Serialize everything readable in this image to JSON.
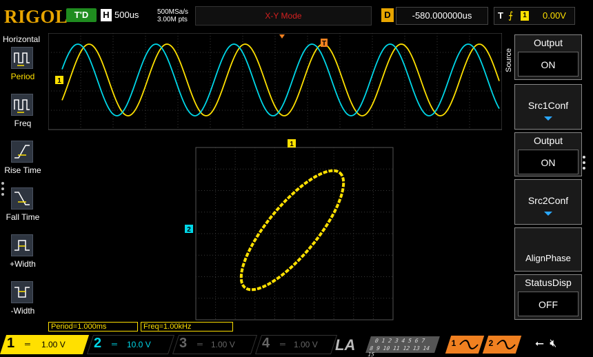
{
  "header": {
    "logo": "RIGOL",
    "run_state": "T'D",
    "horizontal_badge": "H",
    "timebase": "500us",
    "sample_rate": "500MSa/s",
    "memory_depth": "3.00M pts",
    "mode": "X-Y Mode",
    "delay_badge": "D",
    "delay_value": "-580.000000us",
    "trigger_badge": "T",
    "trigger_channel": "1",
    "trigger_level": "0.00V"
  },
  "left_menu": {
    "title": "Horizontal",
    "items": [
      {
        "label": "Period",
        "icon": "period-icon"
      },
      {
        "label": "Freq",
        "icon": "frequency-icon"
      },
      {
        "label": "Rise Time",
        "icon": "rise-time-icon"
      },
      {
        "label": "Fall Time",
        "icon": "fall-time-icon"
      },
      {
        "label": "+Width",
        "icon": "positive-width-icon"
      },
      {
        "label": "-Width",
        "icon": "negative-width-icon"
      }
    ]
  },
  "right_menu": {
    "source_label": "Source",
    "buttons": [
      {
        "head": "Output",
        "value": "ON"
      },
      {
        "label": "Src1Conf"
      },
      {
        "head": "Output",
        "value": "ON"
      },
      {
        "label": "Src2Conf"
      },
      {
        "label": "AlignPhase"
      },
      {
        "head": "StatusDisp",
        "value": "OFF"
      }
    ]
  },
  "display": {
    "ch1_marker": "1",
    "ch2_marker": "2",
    "xy_marker": "1",
    "trigger_marker": "T"
  },
  "measurements": {
    "period": "Period=1.000ms",
    "freq": "Freq=1.00kHz"
  },
  "channels": [
    {
      "num": "1",
      "scale": "1.00 V",
      "color": "#ffe000",
      "active": true
    },
    {
      "num": "2",
      "scale": "10.0 V",
      "color": "#00d7e8",
      "active": true
    },
    {
      "num": "3",
      "scale": "1.00 V",
      "color": "#666666",
      "active": false
    },
    {
      "num": "4",
      "scale": "1.00 V",
      "color": "#666666",
      "active": false
    }
  ],
  "la": {
    "label": "LA",
    "bits_top": "0 1 2 3   4 5 6 7",
    "bits_bottom": "8 9 10 11   12 13 14 15"
  },
  "sources": [
    {
      "num": "1"
    },
    {
      "num": "2"
    }
  ],
  "colors": {
    "ch1": "#ffe000",
    "ch2": "#00d7e8",
    "accent": "#e8a500",
    "source": "#f08020",
    "grid": "#3a3a3a"
  }
}
